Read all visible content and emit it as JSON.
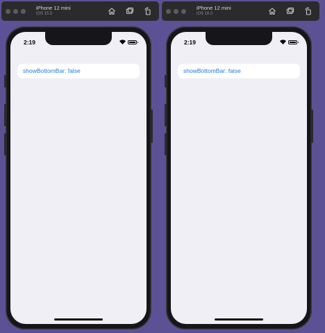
{
  "simulators": [
    {
      "device_name": "iPhone 12 mini",
      "os_version": "iOS 15.5",
      "status_time": "2:19",
      "row_label": "showBottomBar: false"
    },
    {
      "device_name": "iPhone 12 mini",
      "os_version": "iOS 16.0",
      "status_time": "2:19",
      "row_label": "showBottomBar: false"
    }
  ],
  "toolbar_icons": [
    "home-icon",
    "screenshot-icon",
    "rotate-icon"
  ],
  "colors": {
    "desktop_background": "#5d5196",
    "link_blue": "#1a7ae8",
    "screen_background": "#f0eff5"
  }
}
